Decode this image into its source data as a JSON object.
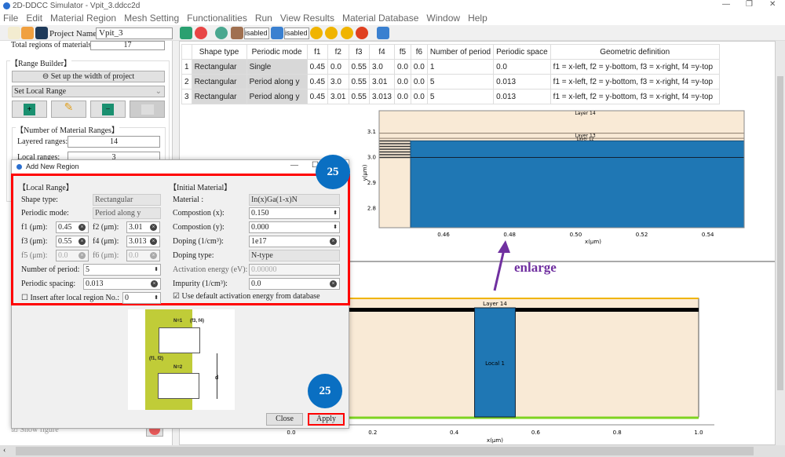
{
  "window": {
    "title": "2D-DDCC Simulator - Vpit_3.ddcc2d"
  },
  "menu": [
    "File",
    "Edit",
    "Material Region",
    "Mesh Setting",
    "Functionalities",
    "Run",
    "View Results",
    "Material Database",
    "Window",
    "Help"
  ],
  "toolbar": {
    "project_label": "Project Name:",
    "project_name": "Vpit_3",
    "combo1": "isabled",
    "combo2": "isabled"
  },
  "left": {
    "total_regions_label": "Total regions of materials:",
    "total_regions": "17",
    "range_builder": "【Range Builder】",
    "width_button": "Set up the width of project",
    "range_select": "Set Local Range",
    "number_group": "【Number of Material Ranges】",
    "layered_label": "Layered ranges:",
    "layered": "14",
    "local_label": "Local ranges:",
    "local": "3",
    "show_figure": "Show figure"
  },
  "table": {
    "headers": [
      "",
      "Shape type",
      "Periodic mode",
      "f1",
      "f2",
      "f3",
      "f4",
      "f5",
      "f6",
      "Number of period",
      "Periodic space",
      "Geometric definition"
    ],
    "rows": [
      [
        "1",
        "Rectangular",
        "Single",
        "0.45",
        "0.0",
        "0.55",
        "3.0",
        "0.0",
        "0.0",
        "1",
        "0.0",
        "f1 = x-left, f2 = y-bottom, f3 = x-right, f4 =y-top"
      ],
      [
        "2",
        "Rectangular",
        "Period along y",
        "0.45",
        "3.0",
        "0.55",
        "3.01",
        "0.0",
        "0.0",
        "5",
        "0.013",
        "f1 = x-left, f2 = y-bottom, f3 = x-right, f4 =y-top"
      ],
      [
        "3",
        "Rectangular",
        "Period along y",
        "0.45",
        "3.01",
        "0.55",
        "3.013",
        "0.0",
        "0.0",
        "5",
        "0.013",
        "f1 = x-left, f2 = y-bottom, f3 = x-right, f4 =y-top"
      ]
    ]
  },
  "dialog": {
    "title": "Add New Region",
    "local_range": "【Local Range】",
    "shape_label": "Shape type:",
    "shape": "Rectangular",
    "mode_label": "Periodic mode:",
    "mode": "Period along y",
    "f1_label": "f1 (μm):",
    "f1": "0.45",
    "f2_label": "f2 (μm):",
    "f2": "3.01",
    "f3_label": "f3 (μm):",
    "f3": "0.55",
    "f4_label": "f4 (μm):",
    "f4": "3.013",
    "f5_label": "f5 (μm):",
    "f5": "0.0",
    "f6_label": "f6 (μm):",
    "f6": "0.0",
    "nperiod_label": "Number of period:",
    "nperiod": "5",
    "spacing_label": "Periodic spacing:",
    "spacing": "0.013",
    "insert_label": "Insert after local region No.:",
    "insert": "0",
    "initial_material": "【Initial Material】",
    "material_label": "Material :",
    "material": "In(x)Ga(1-x)N",
    "compx_label": "Compostion (x):",
    "compx": "0.150",
    "compy_label": "Compostion (y):",
    "compy": "0.000",
    "doping_label": "Doping (1/cm³):",
    "doping": "1e17",
    "dtype_label": "Doping type:",
    "dtype": "N-type",
    "act_label": "Activation energy (eV):",
    "act": "0.00000",
    "imp_label": "Impurity (1/cm³):",
    "imp": "0.0",
    "use_default": "Use default activation energy from database",
    "diagram": {
      "n1": "N=1",
      "n2": "N=2",
      "p34": "(f3, f4)",
      "p12": "(f1, f2)",
      "d": "d"
    },
    "close": "Close",
    "apply": "Apply"
  },
  "annotations": {
    "badge": "25",
    "enlarge": "enlarge",
    "accent": "#0a6fc2",
    "highlight": "#ff0000",
    "arrow": "#7030a0"
  },
  "chart_data": [
    {
      "type": "diagram-plot",
      "xlabel": "x(μm)",
      "ylabel": "y(μm)",
      "xticks": [
        "0.46",
        "0.48",
        "0.50",
        "0.52",
        "0.54"
      ],
      "yticks": [
        "3.1",
        "3.0",
        "2.9",
        "2.8"
      ],
      "xlim": [
        0.4405,
        0.551
      ],
      "ylim": [
        2.725,
        3.183
      ],
      "labels": [
        "Layer 14",
        "Layer 13",
        "Layer 12"
      ],
      "local_rect": {
        "x": [
          0.45,
          0.551
        ],
        "y": [
          2.725,
          3.065
        ]
      }
    },
    {
      "type": "diagram-plot",
      "xlabel": "x(μm)",
      "xticks": [
        "0.0",
        "0.2",
        "0.4",
        "0.6",
        "0.8",
        "1.0"
      ],
      "xlim": [
        0,
        1
      ],
      "labels": [
        "Layer 14",
        "Local 1"
      ],
      "local_rect": {
        "x": [
          0.45,
          0.55
        ]
      }
    }
  ]
}
